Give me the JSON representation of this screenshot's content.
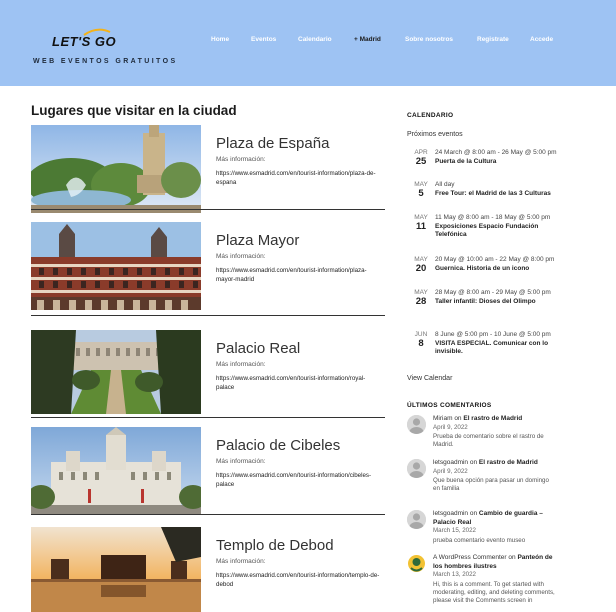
{
  "header": {
    "logo_text": "LET'S GO",
    "tagline": "WEB EVENTOS GRATUITOS",
    "nav": [
      {
        "label": "Home"
      },
      {
        "label": "Eventos"
      },
      {
        "label": "Calendario"
      },
      {
        "label": "+ Madrid"
      },
      {
        "label": "Sobre nosotros"
      },
      {
        "label": "Registrate"
      },
      {
        "label": "Accede"
      }
    ]
  },
  "main": {
    "title": "Lugares que visitar en la ciudad",
    "places": [
      {
        "name": "Plaza de España",
        "more": "Más información:",
        "url": "https://www.esmadrid.com/en/tourist-information/plaza-de-espana"
      },
      {
        "name": "Plaza Mayor",
        "more": "Más información:",
        "url": "https://www.esmadrid.com/en/tourist-information/plaza-mayor-madrid"
      },
      {
        "name": "Palacio Real",
        "more": "Más información:",
        "url": "https://www.esmadrid.com/en/tourist-information/royal-palace"
      },
      {
        "name": "Palacio de Cibeles",
        "more": "Más información:",
        "url": "https://www.esmadrid.com/en/tourist-information/cibeles-palace"
      },
      {
        "name": "Templo de Debod",
        "more": "Más información:",
        "url": "https://www.esmadrid.com/en/tourist-information/templo-de-debod"
      }
    ]
  },
  "sidebar": {
    "calendar_heading": "CALENDARIO",
    "upcoming_label": "Próximos eventos",
    "events": [
      {
        "month": "APR",
        "day": "25",
        "when": "24 March @ 8:00 am - 26 May @ 5:00 pm",
        "title": "Puerta de la Cultura"
      },
      {
        "month": "MAY",
        "day": "5",
        "when": "All day",
        "title": "Free Tour: el Madrid de las 3 Culturas"
      },
      {
        "month": "MAY",
        "day": "11",
        "when": "11 May @ 8:00 am - 18 May @ 5:00 pm",
        "title": "Exposiciones Espacio Fundación Telefónica"
      },
      {
        "month": "MAY",
        "day": "20",
        "when": "20 May @ 10:00 am - 22 May @ 8:00 pm",
        "title": "Guernica. Historia de un icono"
      },
      {
        "month": "MAY",
        "day": "28",
        "when": "28 May @ 8:00 am - 29 May @ 5:00 pm",
        "title": "Taller infantil: Dioses del Olimpo"
      },
      {
        "month": "JUN",
        "day": "8",
        "when": "8 June @ 5:00 pm - 10 June @ 5:00 pm",
        "title": "VISITA ESPECIAL. Comunicar con lo invisible."
      }
    ],
    "view_calendar": "View Calendar",
    "comments_heading": "ÚLTIMOS COMENTARIOS",
    "comments": [
      {
        "author": "Miriam",
        "on": "on",
        "post": "El rastro de Madrid",
        "date": "April 9, 2022",
        "text": "Prueba de comentario sobre el rastro de Madrid."
      },
      {
        "author": "letsgoadmin",
        "on": "on",
        "post": "El rastro de Madrid",
        "date": "April 9, 2022",
        "text": "Que buena opción para pasar un domingo en familia"
      },
      {
        "author": "letsgoadmin",
        "on": "on",
        "post": "Cambio de guardia – Palacio Real",
        "date": "March 15, 2022",
        "text": "prueba comentario evento museo"
      },
      {
        "author": "A WordPress Commenter",
        "on": "on",
        "post": "Panteón de los hombres ilustres",
        "date": "March 13, 2022",
        "text": "Hi, this is a comment. To get started with moderating, editing, and deleting comments, please visit the Comments screen in"
      }
    ]
  }
}
